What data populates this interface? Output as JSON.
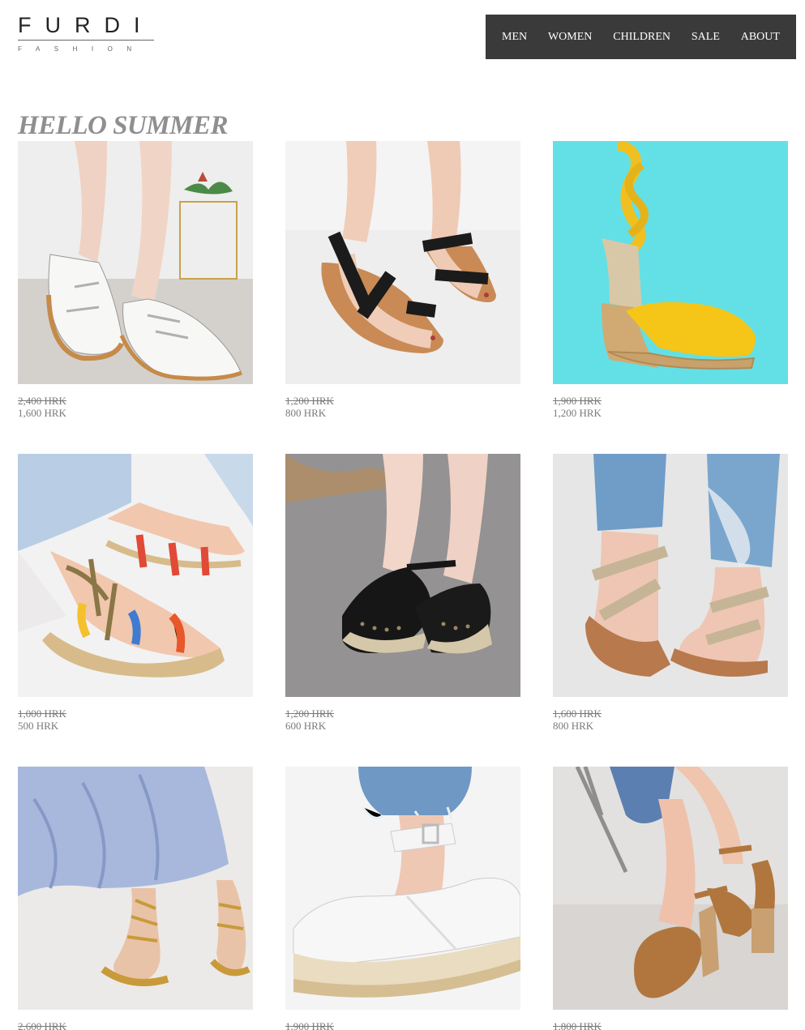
{
  "brand": {
    "name": "FURDI",
    "tagline": "FASHION"
  },
  "nav": {
    "items": [
      {
        "label": "MEN"
      },
      {
        "label": "WOMEN"
      },
      {
        "label": "CHILDREN"
      },
      {
        "label": "SALE"
      },
      {
        "label": "ABOUT"
      }
    ]
  },
  "headline": "HELLO SUMMER",
  "colors": {
    "nav_bg": "#3a3a3a",
    "headline": "#8f8f8f",
    "price_text": "#7a7a7a",
    "turquoise_bg": "#63e0e6"
  },
  "products": [
    {
      "image": "white-leather-flats",
      "old_price": "2,400 HRK",
      "new_price": "1,600 HRK"
    },
    {
      "image": "black-strap-sandals",
      "old_price": "1,200 HRK",
      "new_price": "800 HRK"
    },
    {
      "image": "yellow-espadrille-wedge",
      "old_price": "1,900 HRK",
      "new_price": "1,200 HRK"
    },
    {
      "image": "rope-lace-up-sandals",
      "old_price": "1,000 HRK",
      "new_price": "500 HRK"
    },
    {
      "image": "black-espadrille-wedge",
      "old_price": "1,200 HRK",
      "new_price": "600 HRK"
    },
    {
      "image": "gold-cross-strap-sandals",
      "old_price": "1,600 HRK",
      "new_price": "800 HRK"
    },
    {
      "image": "gold-gladiator-sandals",
      "old_price": "2,600 HRK",
      "new_price": ""
    },
    {
      "image": "white-platform-sandals",
      "old_price": "1,900 HRK",
      "new_price": ""
    },
    {
      "image": "tan-block-heel-sandals",
      "old_price": "1,800 HRK",
      "new_price": ""
    }
  ]
}
